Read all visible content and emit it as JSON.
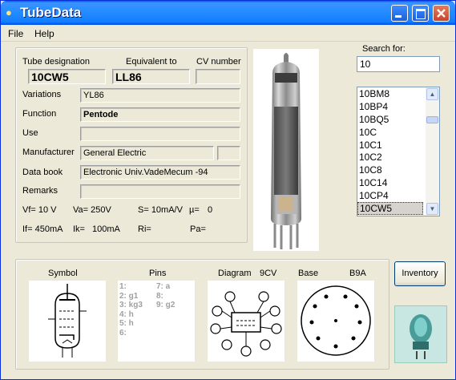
{
  "window": {
    "title": "TubeData"
  },
  "menu": {
    "file": "File",
    "help": "Help"
  },
  "details": {
    "tube_designation_label": "Tube designation",
    "tube_designation": "10CW5",
    "equivalent_label": "Equivalent to",
    "equivalent": "LL86",
    "cv_label": "CV number",
    "cv": "",
    "variations_label": "Variations",
    "variations": "YL86",
    "function_label": "Function",
    "function": "Pentode",
    "use_label": "Use",
    "use": "",
    "manufacturer_label": "Manufacturer",
    "manufacturer": "General Electric",
    "manufacturer_extra": "",
    "databook_label": "Data book",
    "databook": "Electronic Univ.VadeMecum -94",
    "remarks_label": "Remarks",
    "remarks": ""
  },
  "params": {
    "vf": "Vf= 10 V",
    "va": "Va= 250V",
    "s": "S= 10mA/V",
    "mu": "µ=",
    "mu_val": "0",
    "if": "If= 450mA",
    "ik": "Ik=",
    "ik_val": "100mA",
    "ri": "Ri=",
    "pa": "Pa="
  },
  "search": {
    "label": "Search for:",
    "value": "10",
    "results": [
      "10BM8",
      "10BP4",
      "10BQ5",
      "10C",
      "10C1",
      "10C2",
      "10C8",
      "10C14",
      "10CP4",
      "10CW5"
    ],
    "selected": "10CW5"
  },
  "bottom": {
    "symbol_label": "Symbol",
    "pins_label": "Pins",
    "pins_col1": "1:\n2: g1\n3: kg3\n4: h\n5: h\n6:",
    "pins_col2": "7: a\n8:\n9: g2",
    "diagram_label": "Diagram",
    "diagram_code": "9CV",
    "base_label": "Base",
    "base_code": "B9A"
  },
  "inventory_button": "Inventory",
  "colors": {
    "title_bar": "#0a5ef0",
    "window_bg": "#ece9d8",
    "selection": "#d6d3ce"
  }
}
